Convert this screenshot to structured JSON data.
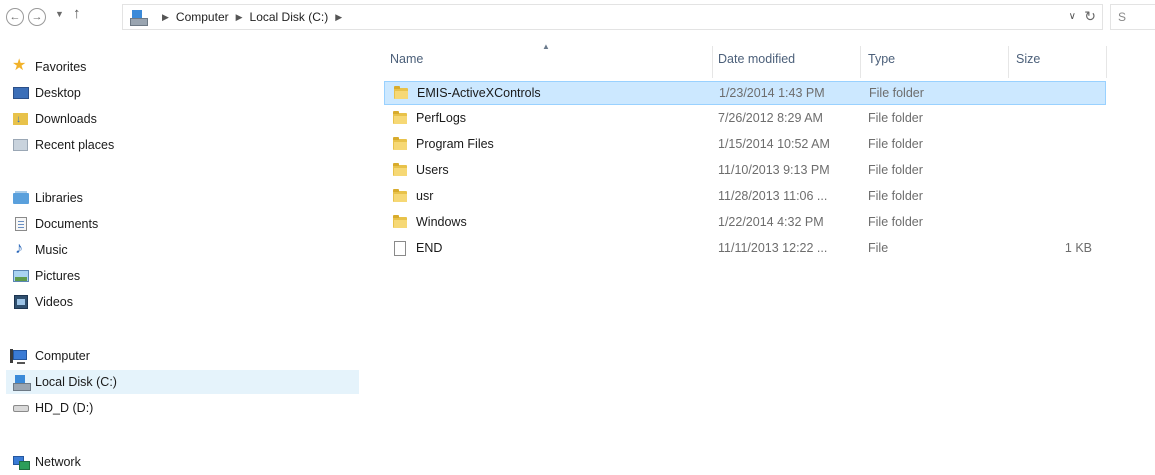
{
  "address_bar": {
    "breadcrumbs": [
      "Computer",
      "Local Disk (C:)"
    ],
    "search_placeholder": "S"
  },
  "nav_pane": {
    "favorites": {
      "label": "Favorites",
      "items": [
        {
          "label": "Desktop",
          "icon": "desktop-icon"
        },
        {
          "label": "Downloads",
          "icon": "downloads-icon"
        },
        {
          "label": "Recent places",
          "icon": "recent-places-icon"
        }
      ]
    },
    "libraries": {
      "label": "Libraries",
      "items": [
        {
          "label": "Documents",
          "icon": "documents-icon"
        },
        {
          "label": "Music",
          "icon": "music-icon"
        },
        {
          "label": "Pictures",
          "icon": "pictures-icon"
        },
        {
          "label": "Videos",
          "icon": "videos-icon"
        }
      ]
    },
    "computer": {
      "label": "Computer",
      "items": [
        {
          "label": "Local Disk (C:)",
          "icon": "local-disk-icon",
          "selected": true
        },
        {
          "label": "HD_D (D:)",
          "icon": "hard-drive-icon"
        }
      ]
    },
    "network": {
      "label": "Network"
    }
  },
  "file_list": {
    "columns": {
      "name": "Name",
      "date": "Date modified",
      "type": "Type",
      "size": "Size"
    },
    "rows": [
      {
        "name": "EMIS-ActiveXControls",
        "date": "1/23/2014 1:43 PM",
        "type": "File folder",
        "size": "",
        "icon": "folder-icon",
        "selected": true
      },
      {
        "name": "PerfLogs",
        "date": "7/26/2012 8:29 AM",
        "type": "File folder",
        "size": "",
        "icon": "folder-icon"
      },
      {
        "name": "Program Files",
        "date": "1/15/2014 10:52 AM",
        "type": "File folder",
        "size": "",
        "icon": "folder-icon"
      },
      {
        "name": "Users",
        "date": "11/10/2013 9:13 PM",
        "type": "File folder",
        "size": "",
        "icon": "folder-icon"
      },
      {
        "name": "usr",
        "date": "11/28/2013 11:06 ...",
        "type": "File folder",
        "size": "",
        "icon": "folder-icon"
      },
      {
        "name": "Windows",
        "date": "1/22/2014 4:32 PM",
        "type": "File folder",
        "size": "",
        "icon": "folder-icon"
      },
      {
        "name": "END",
        "date": "11/11/2013 12:22 ...",
        "type": "File",
        "size": "1 KB",
        "icon": "file-icon"
      }
    ]
  },
  "colors": {
    "selection_fill": "#cce8ff",
    "selection_border": "#99d1ff",
    "nav_selection": "#e5f3fb",
    "header_text": "#4c607a"
  }
}
